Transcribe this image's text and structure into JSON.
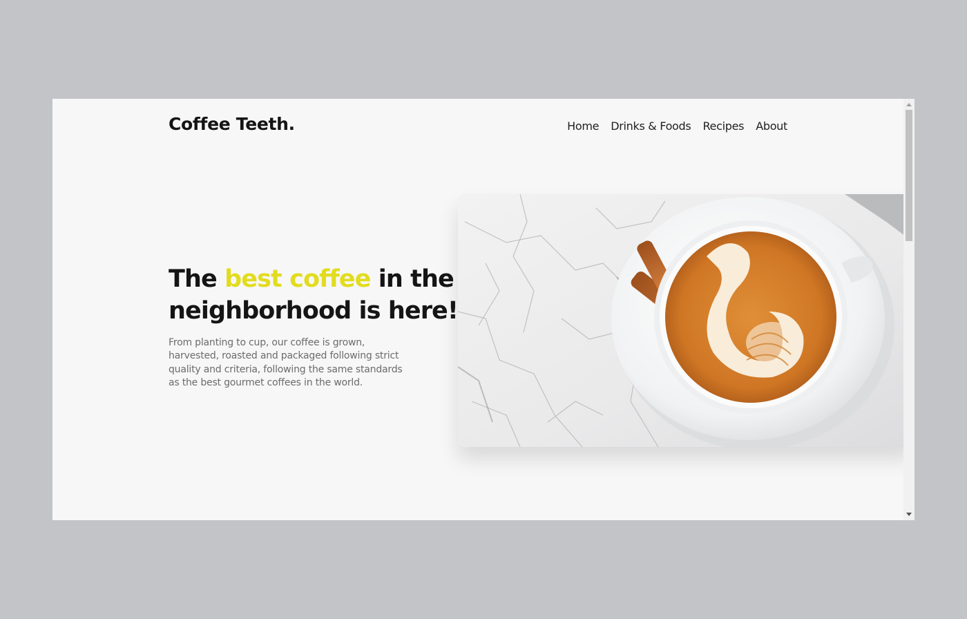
{
  "header": {
    "logo": "Coffee Teeth.",
    "nav": [
      "Home",
      "Drinks & Foods",
      "Recipes",
      "About"
    ]
  },
  "hero": {
    "title_pre": "The ",
    "title_highlight": "best coffee",
    "title_post": " in the neighborhood is here!",
    "description": "From planting to cup, our coffee is grown, harvested, roasted and packaged following strict quality and criteria, following the same standards as the best gourmet coffees in the world.",
    "image": "latte-art-cup-with-cinnamon-sticks"
  },
  "colors": {
    "background": "#f7f7f7",
    "highlight": "#e2dc1f",
    "text": "#151515",
    "muted_text": "#6b6b6b"
  }
}
